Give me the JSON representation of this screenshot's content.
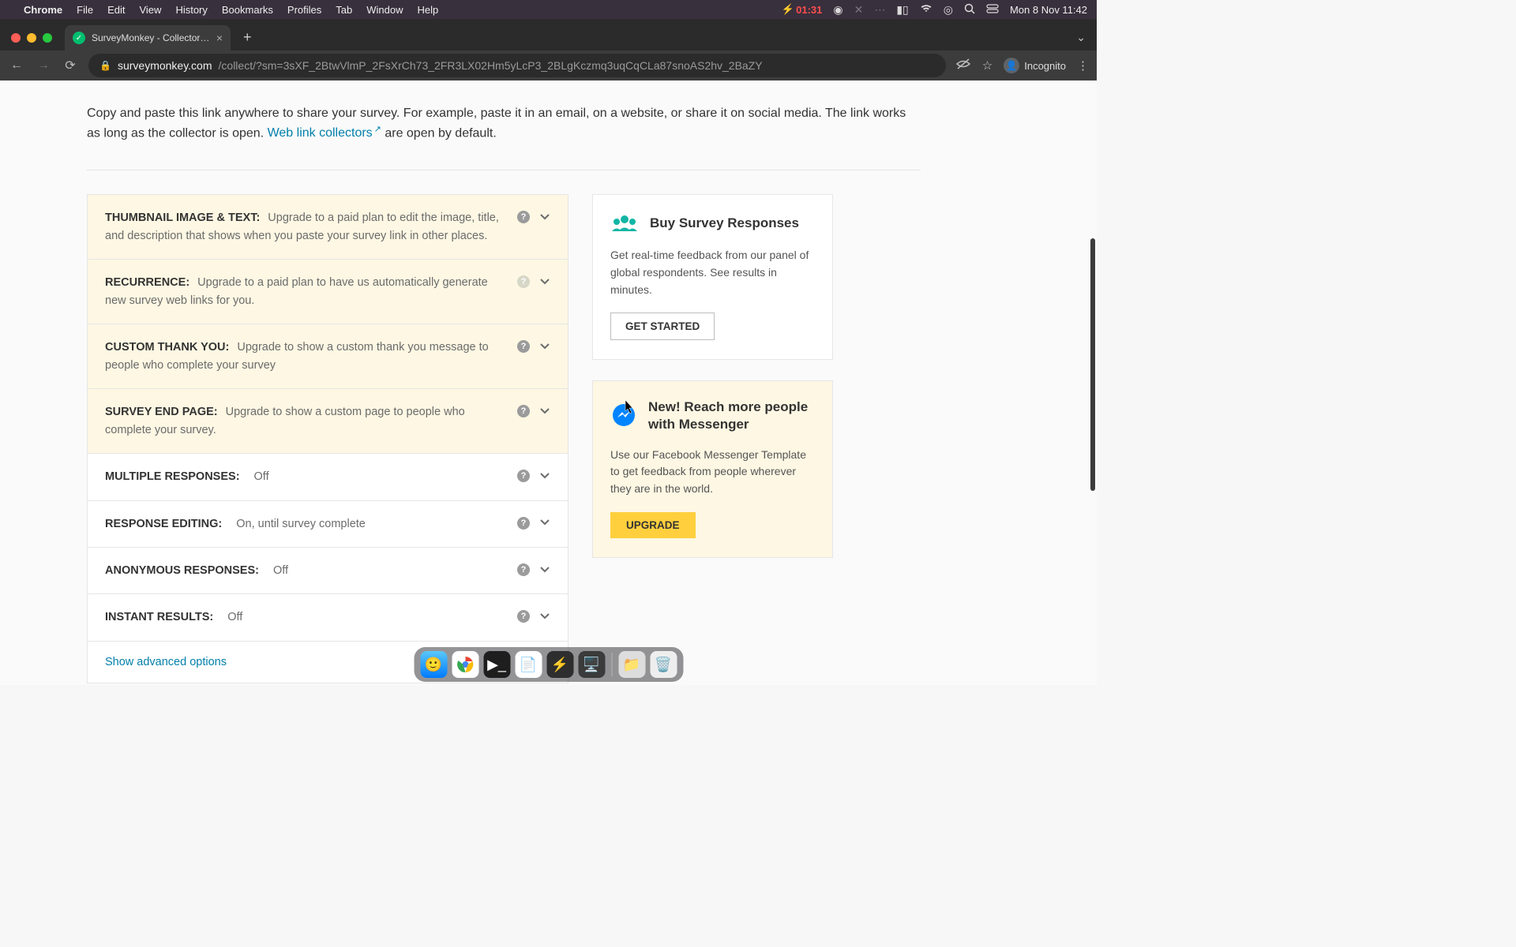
{
  "menubar": {
    "app": "Chrome",
    "items": [
      "File",
      "Edit",
      "View",
      "History",
      "Bookmarks",
      "Profiles",
      "Tab",
      "Window",
      "Help"
    ],
    "battery_time": "01:31",
    "clock": "Mon 8 Nov  11:42"
  },
  "browser": {
    "tab_title": "SurveyMonkey - Collector Det…",
    "url_domain": "surveymonkey.com",
    "url_path": "/collect/?sm=3sXF_2BtwVlmP_2FsXrCh73_2FR3LX02Hm5yLcP3_2BLgKczmq3uqCqCLa87snoAS2hv_2BaZY",
    "incognito_label": "Incognito"
  },
  "intro": {
    "part1": "Copy and paste this link anywhere to share your survey. For example, paste it in an email, on a website, or share it on social media. The link works as long as the collector is open. ",
    "link_text": "Web link collectors",
    "part2": " are open by default."
  },
  "settings": [
    {
      "paid": true,
      "label": "THUMBNAIL IMAGE & TEXT:",
      "desc": "Upgrade to a paid plan to edit the image, title, and description that shows when you paste your survey link in other places.",
      "help_light": false
    },
    {
      "paid": true,
      "label": "RECURRENCE:",
      "desc": "Upgrade to a paid plan to have us automatically generate new survey web links for you.",
      "help_light": true
    },
    {
      "paid": true,
      "label": "CUSTOM THANK YOU:",
      "desc": "Upgrade to show a custom thank you message to people who complete your survey",
      "help_light": false
    },
    {
      "paid": true,
      "label": "SURVEY END PAGE:",
      "desc": "Upgrade to show a custom page to people who complete your survey.",
      "help_light": false
    },
    {
      "paid": false,
      "label": "MULTIPLE RESPONSES:",
      "value": "Off"
    },
    {
      "paid": false,
      "label": "RESPONSE EDITING:",
      "value": "On, until survey complete"
    },
    {
      "paid": false,
      "label": "ANONYMOUS RESPONSES:",
      "value": "Off"
    },
    {
      "paid": false,
      "label": "INSTANT RESULTS:",
      "value": "Off"
    }
  ],
  "show_advanced": "Show advanced options",
  "cards": {
    "buy": {
      "title": "Buy Survey Responses",
      "body": "Get real-time feedback from our panel of global respondents. See results in minutes.",
      "button": "GET STARTED"
    },
    "messenger": {
      "title": "New! Reach more people with Messenger",
      "body": "Use our Facebook Messenger Template to get feedback from people wherever they are in the world.",
      "button": "UPGRADE"
    }
  }
}
